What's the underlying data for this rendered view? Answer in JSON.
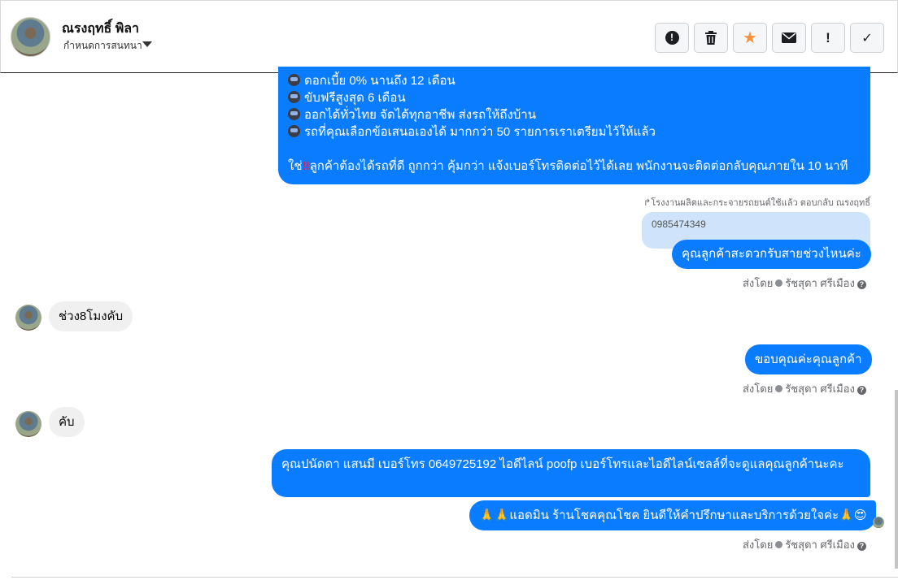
{
  "header": {
    "name": "ณรงฤทธิ์ พิลา",
    "subtitle": "กำหนดการสนทนา"
  },
  "toolbar": {
    "report_icon": "!",
    "delete_icon": "trash",
    "star_icon": "★",
    "mail_icon": "✉",
    "spam_label": "!",
    "done_icon": "✓"
  },
  "accent_color": "#0a7cff",
  "star_color": "#f7923b",
  "messages": {
    "promo_lines": [
      "ดอกเบี้ย 0% นานถึง 12 เดือน",
      "ขับฟรีสูงสุด 6 เดือน",
      "ออกได้ทั่วไทย จัดได้ทุกอาชีพ ส่งรถให้ถึงบ้าน",
      "รถที่คุณเลือกข้อเสนอเองได้ มากกว่า 50 รายการเราเตรียมไว้ให้แล้ว"
    ],
    "promo_cta_prefix": "ใช่",
    "promo_cta_mark": "‼",
    "promo_cta_text": "ลูกค้าต้องได้รถที่ดี ถูกกว่า คุ้มกว่า แจ้งเบอร์โทรติดต่อไว้ได้เลย พนักงานจะติดต่อกลับคุณภายใน 10 นาที",
    "reply_note": "โรงงานผลิตและกระจายรถยนต์ใช้แล้ว ตอบกลับ ณรงฤทธิ์",
    "quoted_text": "0985474349",
    "ask_time": "คุณลูกค้าสะดวกรับสายช่วงไหนค่ะ",
    "customer_reply_1": "ช่วง8โมงคับ",
    "thanks": "ขอบคุณค่ะคุณลูกค้า",
    "customer_reply_2": "คับ",
    "contact_info": "คุณปนัดดา แสนมี   เบอร์โทร 0649725192  ไอดีไลน์ poofp  เบอร์โทรและไอดีไลน์เซลล์ที่จะดูแลคุณลูกค้านะคะ",
    "admin_signoff": "แอดมิน ร้านโชคคุณโชค ยินดีให้คำปรึกษาและบริการด้วยใจค่ะ"
  },
  "sent_by": {
    "label": "ส่งโดย",
    "agent": "รัชสุดา ศรีเมือง",
    "help": "?"
  }
}
